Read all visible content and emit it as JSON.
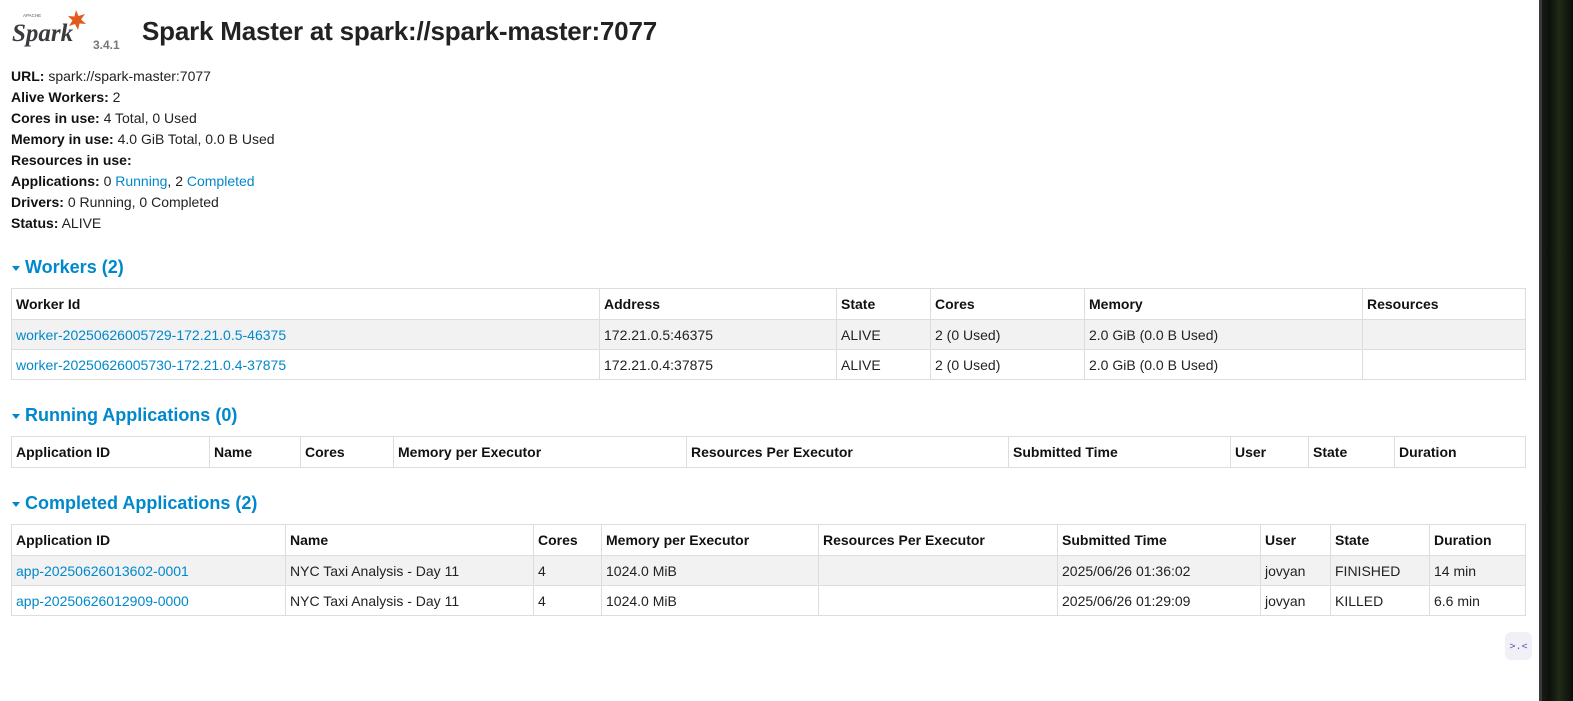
{
  "header": {
    "brand": "Spark",
    "apache": "APACHE",
    "version": "3.4.1",
    "title": "Spark Master at spark://spark-master:7077"
  },
  "summary": {
    "url_label": "URL:",
    "url_value": "spark://spark-master:7077",
    "workers_label": "Alive Workers:",
    "workers_value": "2",
    "cores_label": "Cores in use:",
    "cores_value": "4 Total, 0 Used",
    "memory_label": "Memory in use:",
    "memory_value": "4.0 GiB Total, 0.0 B Used",
    "resources_label": "Resources in use:",
    "apps_label": "Applications:",
    "apps_running_count": "0",
    "apps_running_link": "Running",
    "apps_sep": ",",
    "apps_completed_count": "2",
    "apps_completed_link": "Completed",
    "drivers_label": "Drivers:",
    "drivers_value": "0 Running, 0 Completed",
    "status_label": "Status:",
    "status_value": "ALIVE"
  },
  "workers": {
    "heading": "Workers (2)",
    "columns": [
      "Worker Id",
      "Address",
      "State",
      "Cores",
      "Memory",
      "Resources"
    ],
    "rows": [
      [
        "worker-20250626005729-172.21.0.5-46375",
        "172.21.0.5:46375",
        "ALIVE",
        "2 (0 Used)",
        "2.0 GiB (0.0 B Used)",
        ""
      ],
      [
        "worker-20250626005730-172.21.0.4-37875",
        "172.21.0.4:37875",
        "ALIVE",
        "2 (0 Used)",
        "2.0 GiB (0.0 B Used)",
        ""
      ]
    ]
  },
  "running": {
    "heading": "Running Applications (0)",
    "columns": [
      "Application ID",
      "Name",
      "Cores",
      "Memory per Executor",
      "Resources Per Executor",
      "Submitted Time",
      "User",
      "State",
      "Duration"
    ]
  },
  "completed": {
    "heading": "Completed Applications (2)",
    "columns": [
      "Application ID",
      "Name",
      "Cores",
      "Memory per Executor",
      "Resources Per Executor",
      "Submitted Time",
      "User",
      "State",
      "Duration"
    ],
    "rows": [
      [
        "app-20250626013602-0001",
        "NYC Taxi Analysis - Day 11",
        "4",
        "1024.0 MiB",
        "",
        "2025/06/26 01:36:02",
        "jovyan",
        "FINISHED",
        "14 min"
      ],
      [
        "app-20250626012909-0000",
        "NYC Taxi Analysis - Day 11",
        "4",
        "1024.0 MiB",
        "",
        "2025/06/26 01:29:09",
        "jovyan",
        "KILLED",
        "6.6 min"
      ]
    ]
  },
  "colors": {
    "link": "#0088cc",
    "stripe": "#f2f2f2",
    "border": "#dddddd",
    "logo_star": "#e25a1c"
  },
  "icons": {
    "section_toggle": "caret-down-icon",
    "float": "chat-widget-icon"
  },
  "float_button": {
    "glyph": ">.<"
  }
}
